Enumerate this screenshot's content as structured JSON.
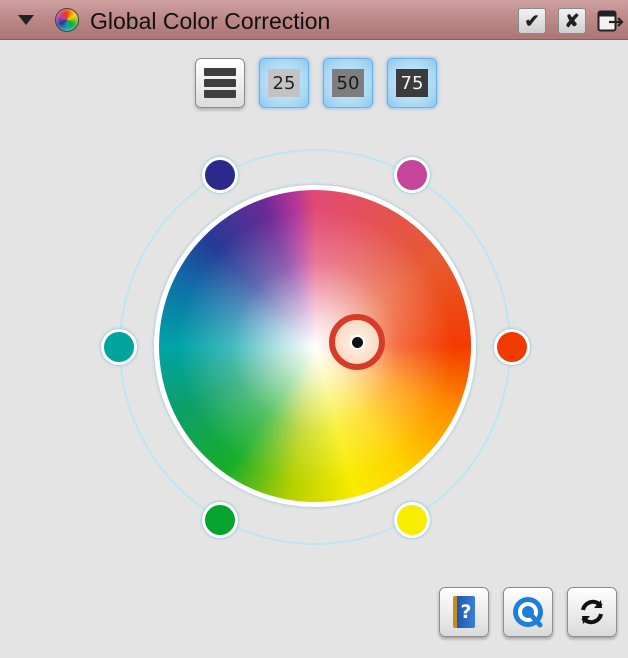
{
  "window": {
    "title": "Global Color Correction",
    "confirm_glyph": "✔",
    "close_glyph": "✘"
  },
  "toolbar": {
    "layers_icon": "layers-icon",
    "levels": [
      {
        "label": "25"
      },
      {
        "label": "50"
      },
      {
        "label": "75"
      }
    ]
  },
  "color_wheel": {
    "nodes": [
      {
        "name": "blue",
        "color": "#2b2a8c"
      },
      {
        "name": "magenta",
        "color": "#c5459a"
      },
      {
        "name": "cyan",
        "color": "#00a49e"
      },
      {
        "name": "red",
        "color": "#f23b00"
      },
      {
        "name": "green",
        "color": "#05a42e"
      },
      {
        "name": "yellow",
        "color": "#f8ec00"
      }
    ],
    "picker_color": "#d63c2a"
  },
  "footer": {
    "help_glyph": "?",
    "icons": [
      "help-book-icon",
      "quicktime-icon",
      "reset-icon"
    ]
  }
}
